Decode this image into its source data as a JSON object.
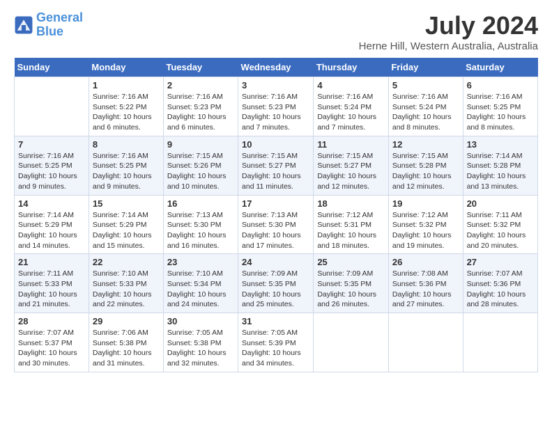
{
  "logo": {
    "line1": "General",
    "line2": "Blue"
  },
  "title": "July 2024",
  "subtitle": "Herne Hill, Western Australia, Australia",
  "days_of_week": [
    "Sunday",
    "Monday",
    "Tuesday",
    "Wednesday",
    "Thursday",
    "Friday",
    "Saturday"
  ],
  "weeks": [
    [
      {
        "day": "",
        "info": ""
      },
      {
        "day": "1",
        "info": "Sunrise: 7:16 AM\nSunset: 5:22 PM\nDaylight: 10 hours\nand 6 minutes."
      },
      {
        "day": "2",
        "info": "Sunrise: 7:16 AM\nSunset: 5:23 PM\nDaylight: 10 hours\nand 6 minutes."
      },
      {
        "day": "3",
        "info": "Sunrise: 7:16 AM\nSunset: 5:23 PM\nDaylight: 10 hours\nand 7 minutes."
      },
      {
        "day": "4",
        "info": "Sunrise: 7:16 AM\nSunset: 5:24 PM\nDaylight: 10 hours\nand 7 minutes."
      },
      {
        "day": "5",
        "info": "Sunrise: 7:16 AM\nSunset: 5:24 PM\nDaylight: 10 hours\nand 8 minutes."
      },
      {
        "day": "6",
        "info": "Sunrise: 7:16 AM\nSunset: 5:25 PM\nDaylight: 10 hours\nand 8 minutes."
      }
    ],
    [
      {
        "day": "7",
        "info": "Sunrise: 7:16 AM\nSunset: 5:25 PM\nDaylight: 10 hours\nand 9 minutes."
      },
      {
        "day": "8",
        "info": "Sunrise: 7:16 AM\nSunset: 5:25 PM\nDaylight: 10 hours\nand 9 minutes."
      },
      {
        "day": "9",
        "info": "Sunrise: 7:15 AM\nSunset: 5:26 PM\nDaylight: 10 hours\nand 10 minutes."
      },
      {
        "day": "10",
        "info": "Sunrise: 7:15 AM\nSunset: 5:27 PM\nDaylight: 10 hours\nand 11 minutes."
      },
      {
        "day": "11",
        "info": "Sunrise: 7:15 AM\nSunset: 5:27 PM\nDaylight: 10 hours\nand 12 minutes."
      },
      {
        "day": "12",
        "info": "Sunrise: 7:15 AM\nSunset: 5:28 PM\nDaylight: 10 hours\nand 12 minutes."
      },
      {
        "day": "13",
        "info": "Sunrise: 7:14 AM\nSunset: 5:28 PM\nDaylight: 10 hours\nand 13 minutes."
      }
    ],
    [
      {
        "day": "14",
        "info": "Sunrise: 7:14 AM\nSunset: 5:29 PM\nDaylight: 10 hours\nand 14 minutes."
      },
      {
        "day": "15",
        "info": "Sunrise: 7:14 AM\nSunset: 5:29 PM\nDaylight: 10 hours\nand 15 minutes."
      },
      {
        "day": "16",
        "info": "Sunrise: 7:13 AM\nSunset: 5:30 PM\nDaylight: 10 hours\nand 16 minutes."
      },
      {
        "day": "17",
        "info": "Sunrise: 7:13 AM\nSunset: 5:30 PM\nDaylight: 10 hours\nand 17 minutes."
      },
      {
        "day": "18",
        "info": "Sunrise: 7:12 AM\nSunset: 5:31 PM\nDaylight: 10 hours\nand 18 minutes."
      },
      {
        "day": "19",
        "info": "Sunrise: 7:12 AM\nSunset: 5:32 PM\nDaylight: 10 hours\nand 19 minutes."
      },
      {
        "day": "20",
        "info": "Sunrise: 7:11 AM\nSunset: 5:32 PM\nDaylight: 10 hours\nand 20 minutes."
      }
    ],
    [
      {
        "day": "21",
        "info": "Sunrise: 7:11 AM\nSunset: 5:33 PM\nDaylight: 10 hours\nand 21 minutes."
      },
      {
        "day": "22",
        "info": "Sunrise: 7:10 AM\nSunset: 5:33 PM\nDaylight: 10 hours\nand 22 minutes."
      },
      {
        "day": "23",
        "info": "Sunrise: 7:10 AM\nSunset: 5:34 PM\nDaylight: 10 hours\nand 24 minutes."
      },
      {
        "day": "24",
        "info": "Sunrise: 7:09 AM\nSunset: 5:35 PM\nDaylight: 10 hours\nand 25 minutes."
      },
      {
        "day": "25",
        "info": "Sunrise: 7:09 AM\nSunset: 5:35 PM\nDaylight: 10 hours\nand 26 minutes."
      },
      {
        "day": "26",
        "info": "Sunrise: 7:08 AM\nSunset: 5:36 PM\nDaylight: 10 hours\nand 27 minutes."
      },
      {
        "day": "27",
        "info": "Sunrise: 7:07 AM\nSunset: 5:36 PM\nDaylight: 10 hours\nand 28 minutes."
      }
    ],
    [
      {
        "day": "28",
        "info": "Sunrise: 7:07 AM\nSunset: 5:37 PM\nDaylight: 10 hours\nand 30 minutes."
      },
      {
        "day": "29",
        "info": "Sunrise: 7:06 AM\nSunset: 5:38 PM\nDaylight: 10 hours\nand 31 minutes."
      },
      {
        "day": "30",
        "info": "Sunrise: 7:05 AM\nSunset: 5:38 PM\nDaylight: 10 hours\nand 32 minutes."
      },
      {
        "day": "31",
        "info": "Sunrise: 7:05 AM\nSunset: 5:39 PM\nDaylight: 10 hours\nand 34 minutes."
      },
      {
        "day": "",
        "info": ""
      },
      {
        "day": "",
        "info": ""
      },
      {
        "day": "",
        "info": ""
      }
    ]
  ]
}
